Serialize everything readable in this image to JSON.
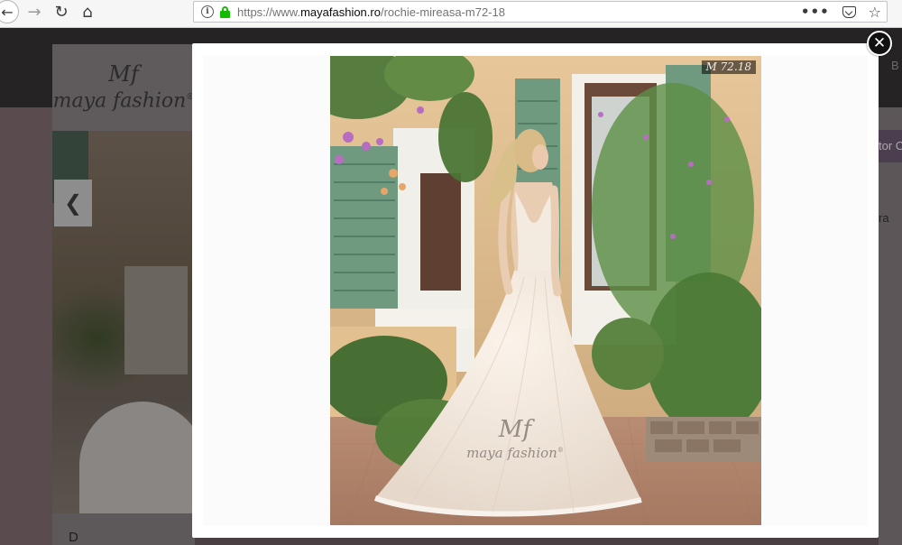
{
  "browser": {
    "back_glyph": "←",
    "forward_glyph": "→",
    "reload_glyph": "↻",
    "home_glyph": "⌂",
    "url_scheme": "https://www.",
    "url_host": "mayafashion.ro",
    "url_path": "/rochie-mireasa-m72-18",
    "more_glyph": "•••",
    "star_glyph": "☆",
    "icons": [
      "back-icon",
      "forward-icon",
      "reload-icon",
      "home-icon",
      "info-icon",
      "lock-icon",
      "more-icon",
      "pocket-icon",
      "bookmark-star-icon"
    ],
    "lock_color": "#12bc00"
  },
  "site": {
    "logo_mark": "Mf",
    "logo_text": "maya fashion",
    "logo_reg": "®",
    "prev_glyph": "❮",
    "bottom_label": "D",
    "right_nav_text": "B",
    "right_tab1_text": "tor C",
    "right_tab2_text": "ra"
  },
  "lightbox": {
    "model_code": "M 72.18",
    "watermark_mark": "Mf",
    "watermark_text": "maya fashion",
    "watermark_reg": "®",
    "close_glyph": "✕"
  }
}
